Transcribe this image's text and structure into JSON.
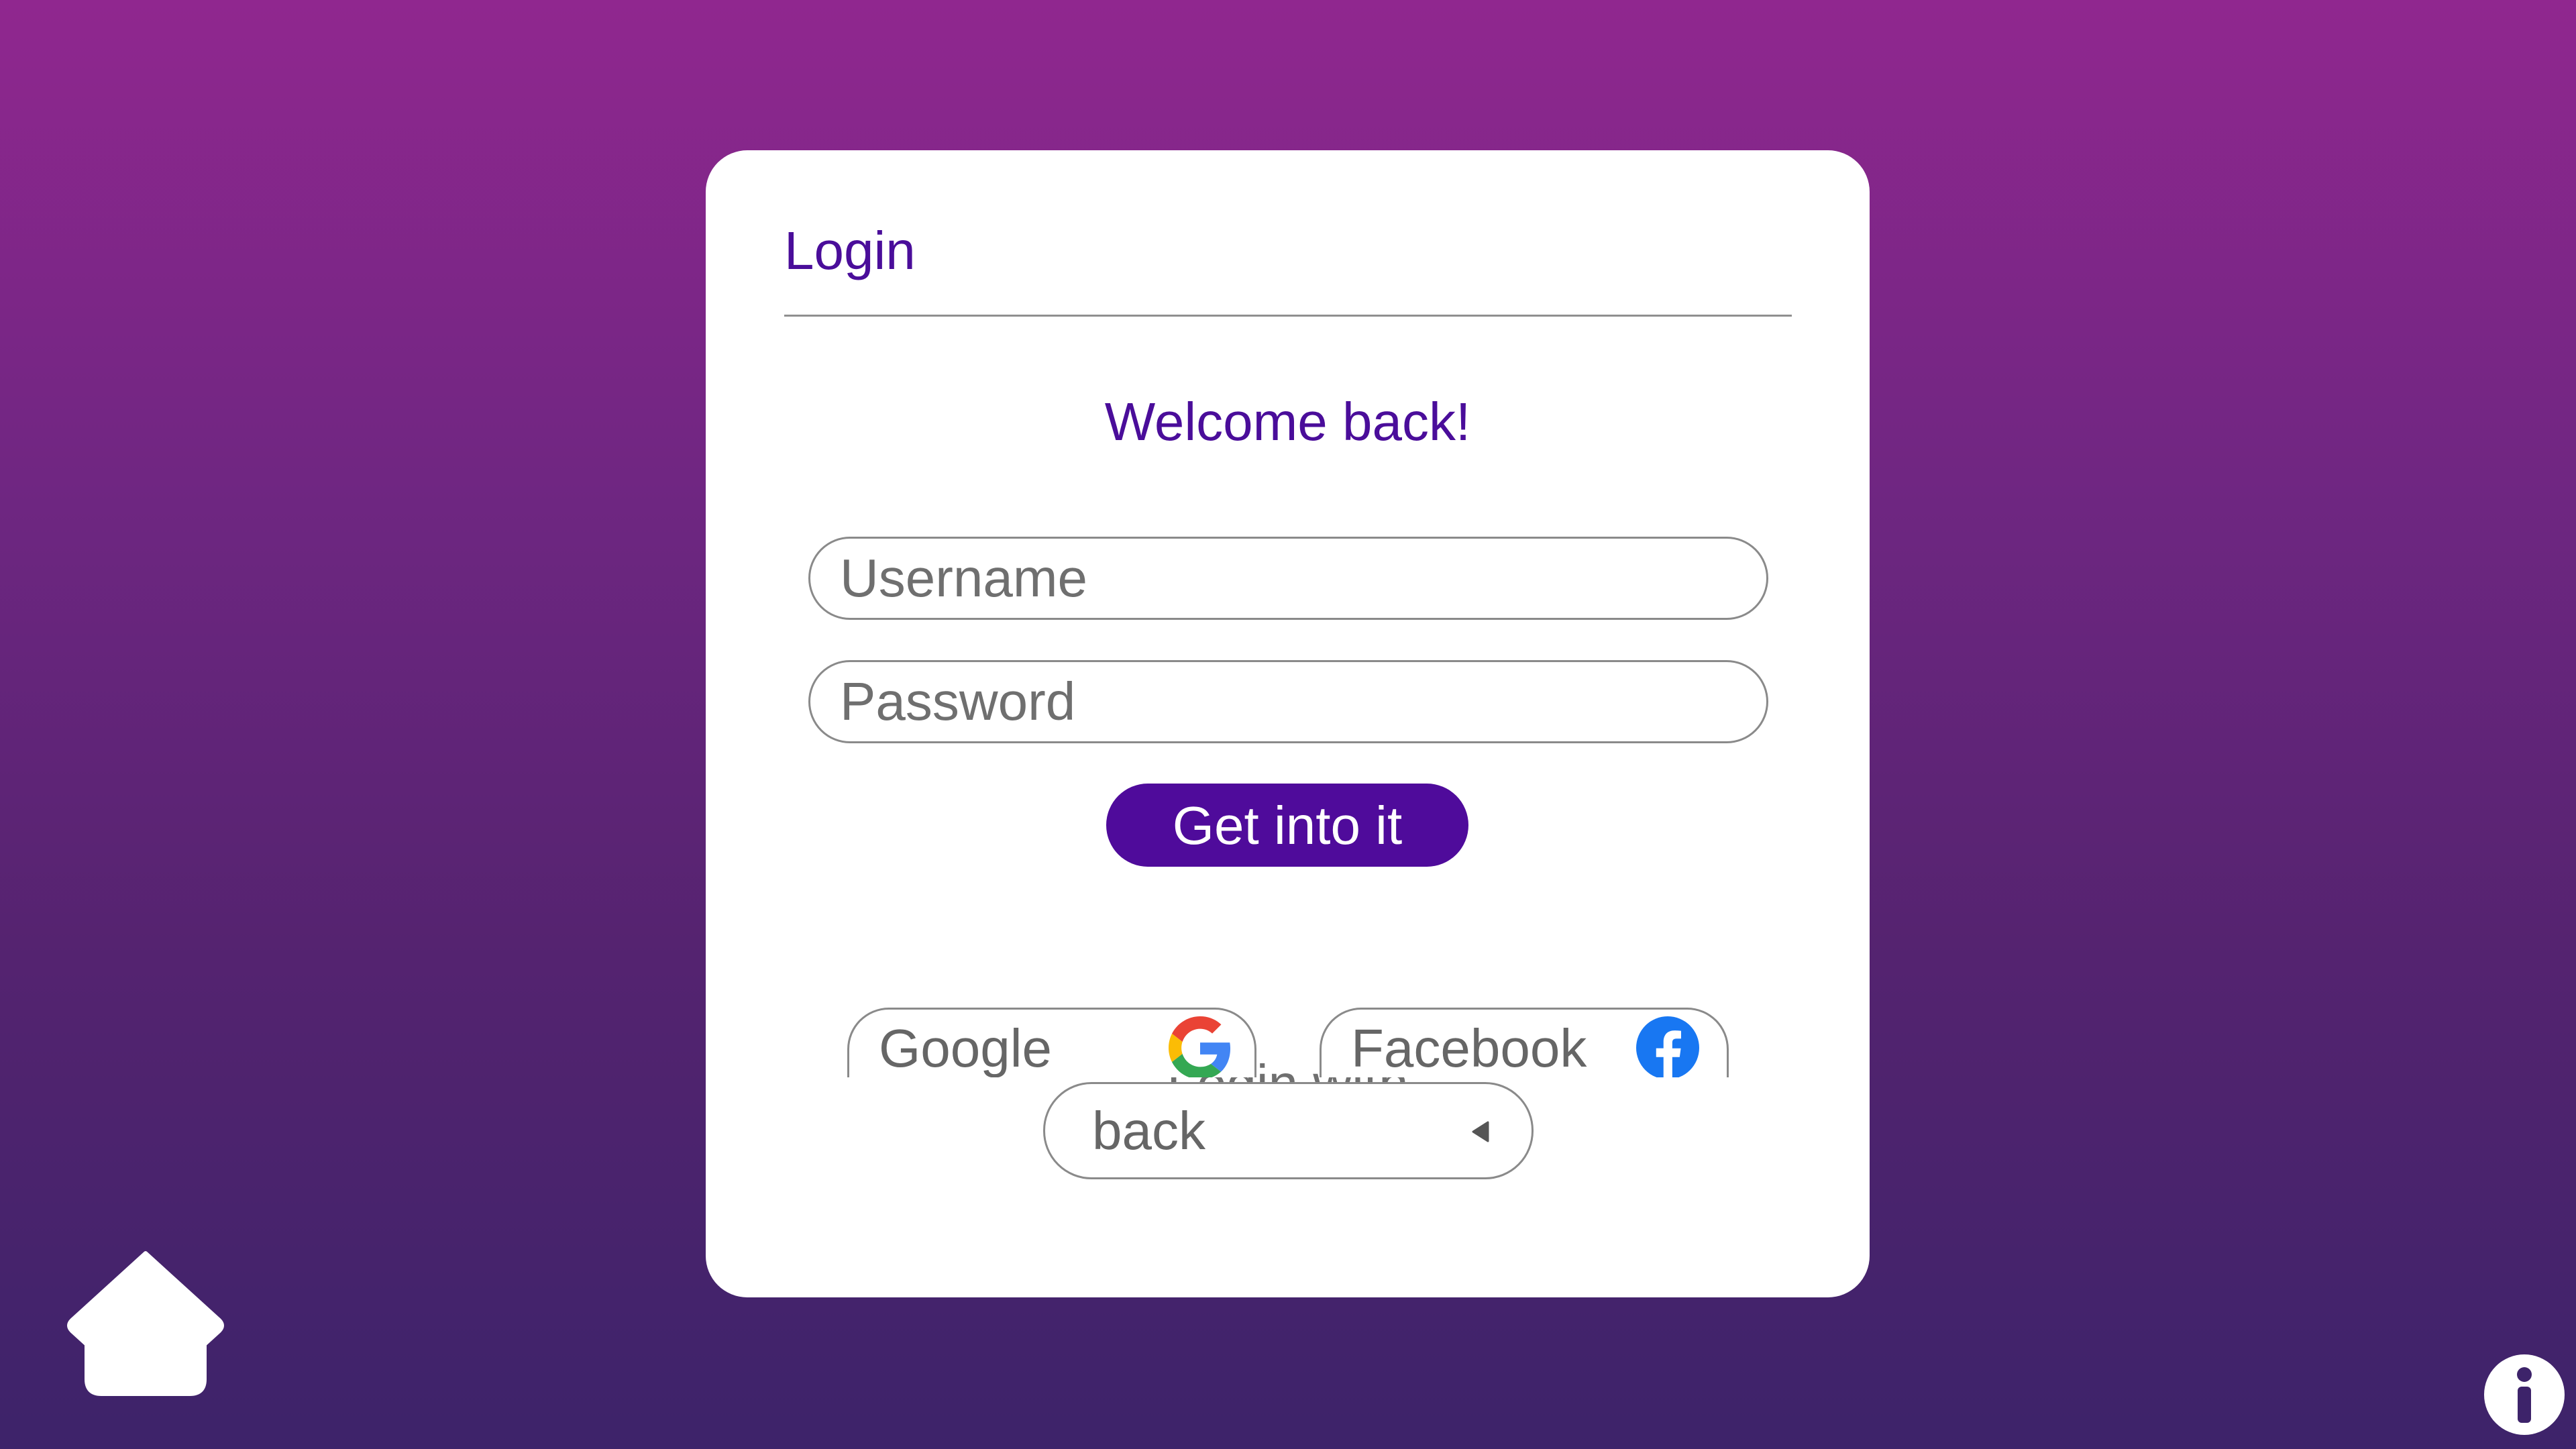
{
  "login_card": {
    "title": "Login",
    "welcome": "Welcome back!",
    "username_placeholder": "Username",
    "password_placeholder": "Password",
    "submit_label": "Get into it",
    "login_with_label": "Login with",
    "social": {
      "google_label": "Google",
      "facebook_label": "Facebook"
    },
    "back_label": "back"
  },
  "icons": {
    "home": "home-icon",
    "info": "info-icon",
    "google": "google-icon",
    "facebook": "facebook-icon",
    "back_arrow": "caret-left-icon"
  },
  "colors": {
    "accent": "#4f0b9b",
    "title_text": "#4a0d9a",
    "background_top": "#90278f",
    "background_bottom": "#3d236a",
    "facebook_blue": "#1877f2"
  }
}
